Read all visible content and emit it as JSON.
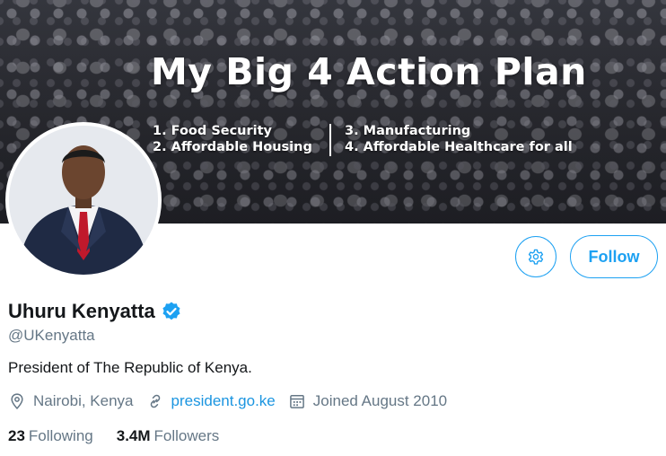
{
  "banner": {
    "title": "My Big 4 Action Plan",
    "items_left": [
      "1.  Food Security",
      "2. Affordable Housing"
    ],
    "items_right": [
      "3. Manufacturing",
      "4. Affordable Healthcare for all"
    ]
  },
  "profile": {
    "name": "Uhuru Kenyatta",
    "handle": "@UKenyatta",
    "bio": "President of The Republic of Kenya.",
    "location": "Nairobi, Kenya",
    "website": "president.go.ke",
    "joined": "Joined August 2010"
  },
  "actions": {
    "follow_label": "Follow"
  },
  "stats": {
    "following_count": "23",
    "following_label": "Following",
    "followers_count": "3.4M",
    "followers_label": "Followers"
  },
  "colors": {
    "accent": "#1da1f2",
    "secondary_text": "#657786"
  },
  "icons": {
    "settings": "gear-icon",
    "verified": "verified-badge-icon",
    "location": "location-pin-icon",
    "link": "link-icon",
    "calendar": "calendar-icon"
  }
}
